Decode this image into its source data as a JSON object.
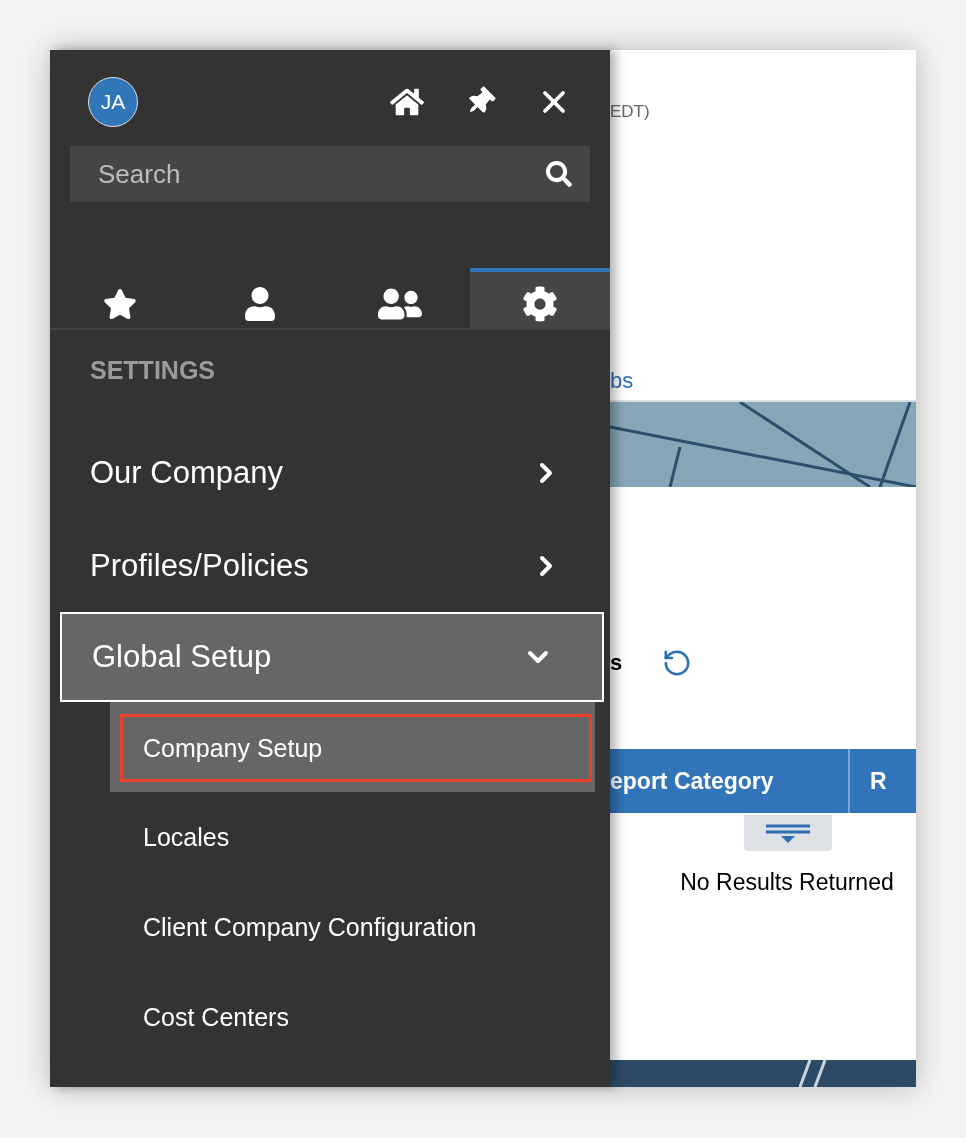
{
  "panel": {
    "avatar": {
      "initials": "JA"
    },
    "search": {
      "placeholder": "Search"
    },
    "tabs": [
      {
        "kind": "star",
        "selected": false
      },
      {
        "kind": "person",
        "selected": false
      },
      {
        "kind": "people",
        "selected": false
      },
      {
        "kind": "gear",
        "selected": true
      }
    ],
    "section_title": "SETTINGS",
    "menu": [
      {
        "label": "Our Company",
        "expanded": false
      },
      {
        "label": "Profiles/Policies",
        "expanded": false
      },
      {
        "label": "Global Setup",
        "expanded": true,
        "children": [
          {
            "label": "Company Setup",
            "selected": true
          },
          {
            "label": "Locales",
            "selected": false
          },
          {
            "label": "Client Company Configuration",
            "selected": false
          },
          {
            "label": "Cost Centers",
            "selected": false
          }
        ]
      }
    ]
  },
  "page": {
    "timezone_fragment": "EDT)",
    "link_fragment": "bs",
    "heading_fragment": "s",
    "table": {
      "columns": [
        "eport Category",
        "R"
      ],
      "empty_message": "No Results Returned"
    }
  }
}
